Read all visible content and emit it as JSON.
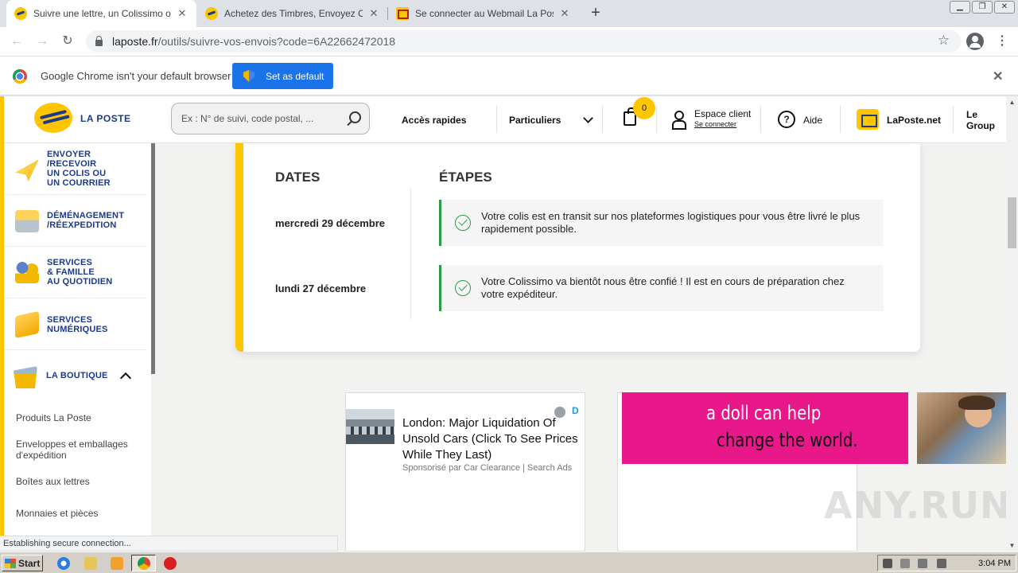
{
  "browser": {
    "tabs": [
      {
        "title": "Suivre une lettre, un Colissimo ou un",
        "favicon": "laposte-icon",
        "active": true
      },
      {
        "title": "Achetez des Timbres, Envoyez Cour",
        "favicon": "laposte-icon",
        "active": false
      },
      {
        "title": "Se connecter au Webmail La Poste -",
        "favicon": "mail-icon",
        "active": false
      }
    ],
    "tab_close": "✕",
    "new_tab": "+",
    "window_controls": {
      "minimize": "▁",
      "restore": "❐",
      "close": "✕"
    },
    "nav": {
      "back": "←",
      "forward": "→",
      "reload": "↻"
    },
    "url": {
      "host": "laposte.fr",
      "path": "/outils/suivre-vos-envois?code=6A22662472018"
    },
    "star": "☆",
    "menu": "⋮"
  },
  "infobar": {
    "message": "Google Chrome isn't your default browser",
    "button": "Set as default",
    "close": "✕"
  },
  "site_header": {
    "logo_text": "LA POSTE",
    "search_placeholder": "Ex : N° de suivi, code postal, ...",
    "quick_access": "Accès rapides",
    "audience": "Particuliers",
    "cart_count": "0",
    "account_title": "Espace client",
    "account_link": "Se connecter",
    "help_icon_glyph": "?",
    "help": "Aide",
    "laposte_net": "LaPoste.net",
    "groupe": "Le Group"
  },
  "sidebar": {
    "items": [
      {
        "label_lines": [
          "ENVOYER",
          "/RECEVOIR",
          "UN COLIS OU",
          "UN COURRIER"
        ],
        "icon": "paper-plane-icon"
      },
      {
        "label_lines": [
          "DÉMÉNAGEMENT",
          "/RÉEXPEDITION"
        ],
        "icon": "moving-box-icon"
      },
      {
        "label_lines": [
          "SERVICES",
          "& FAMILLE",
          "AU QUOTIDIEN"
        ],
        "icon": "family-icon"
      },
      {
        "label_lines": [
          "SERVICES",
          "NUMÉRIQUES"
        ],
        "icon": "digital-services-icon"
      }
    ],
    "boutique": {
      "label": "LA BOUTIQUE",
      "icon": "shop-basket-icon",
      "expanded": true
    },
    "boutique_links": [
      "Produits La Poste",
      "Enveloppes et emballages d'expédition",
      "Boîtes aux lettres",
      "Monnaies et pièces"
    ]
  },
  "tracking": {
    "dates_header": "DATES",
    "steps_header": "ÉTAPES",
    "events": [
      {
        "date": "mercredi 29 décembre",
        "text": "Votre colis est en transit sur nos plateformes logistiques pour vous être livré le plus rapidement possible."
      },
      {
        "date": "lundi 27 décembre",
        "text": "Votre Colissimo va bientôt nous être confié ! Il est en cours de préparation chez votre expéditeur."
      }
    ],
    "status_color": "#2b9a47",
    "accent_color": "#ffc500"
  },
  "ads": {
    "left": {
      "title": "London: Major Liquidation Of Unsold Cars (Click To See Prices While They Last)",
      "sponsor": "Sponsorisé par Car Clearance | Search Ads",
      "adchoices_label": "D"
    },
    "right": {
      "line1": "a doll can help",
      "line2": "change the world.",
      "color": "#e8178a"
    }
  },
  "watermark": "ANY.RUN",
  "status_bar": "Establishing secure connection...",
  "taskbar": {
    "start": "Start",
    "clock": "3:04 PM"
  }
}
